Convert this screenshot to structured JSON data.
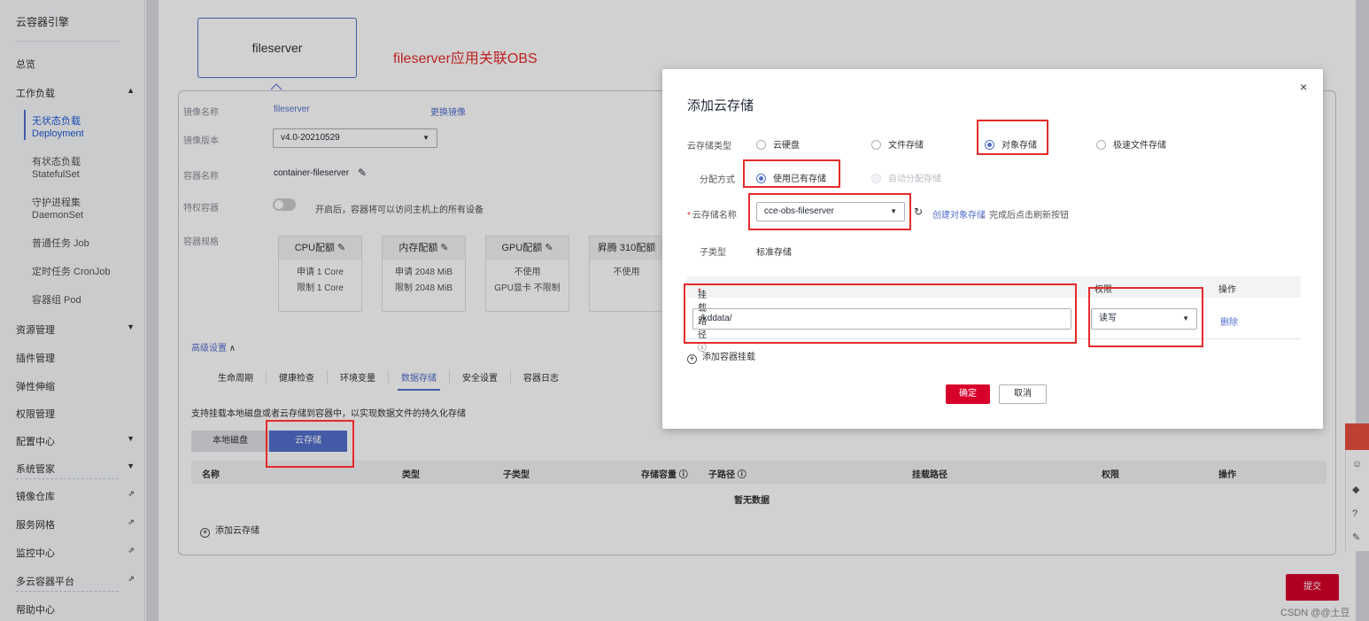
{
  "sidebar": {
    "title": "云容器引擎",
    "overview": "总览",
    "workload": "工作负载",
    "subs": [
      {
        "line1": "无状态负载",
        "line2": "Deployment"
      },
      {
        "line1": "有状态负载",
        "line2": "StatefulSet"
      },
      {
        "line1": "守护进程集",
        "line2": "DaemonSet"
      },
      {
        "line1": "普通任务 Job",
        "line2": ""
      },
      {
        "line1": "定时任务 CronJob",
        "line2": ""
      },
      {
        "line1": "容器组 Pod",
        "line2": ""
      }
    ],
    "items": [
      "资源管理",
      "插件管理",
      "弹性伸缩",
      "权限管理",
      "配置中心",
      "系统管家",
      "镜像仓库",
      "服务网格",
      "监控中心",
      "多云容器平台",
      "帮助中心"
    ]
  },
  "app_card": {
    "name": "fileserver"
  },
  "caption": "fileserver应用关联OBS",
  "form": {
    "image_name_label": "镜像名称",
    "image_name": "fileserver",
    "change_image": "更换镜像",
    "image_version_label": "镜像版本",
    "image_version": "v4.0-20210529",
    "container_name_label": "容器名称",
    "container_name": "container-fileserver",
    "privileged_label": "特权容器",
    "privileged_hint": "开启后，容器将可以访问主机上的所有设备",
    "spec_label": "容器规格",
    "quotas": [
      {
        "head": "CPU配额",
        "l1": "申请 1 Core",
        "l2": "限制 1 Core"
      },
      {
        "head": "内存配额",
        "l1": "申请 2048 MiB",
        "l2": "限制 2048 MiB"
      },
      {
        "head": "GPU配额",
        "l1": "不使用",
        "l2": "GPU显卡 不限制"
      },
      {
        "head": "昇腾 310配额",
        "l1": "不使用",
        "l2": ""
      }
    ],
    "advanced": "高级设置",
    "tabs": [
      "生命周期",
      "健康检查",
      "环境变量",
      "数据存储",
      "安全设置",
      "容器日志"
    ],
    "storage_hint": "支持挂载本地磁盘或者云存储到容器中，以实现数据文件的持久化存储",
    "seg_local": "本地磁盘",
    "seg_cloud": "云存储",
    "table_headers": [
      "名称",
      "类型",
      "子类型",
      "存储容量 ⓘ",
      "子路径 ⓘ",
      "挂载路径",
      "权限",
      "操作"
    ],
    "no_data": "暂无数据",
    "add_cloud_storage": "添加云存储"
  },
  "submit": "提交",
  "watermark": "CSDN @@土豆",
  "modal": {
    "title": "添加云存储",
    "close": "×",
    "type_label": "云存储类型",
    "types": [
      "云硬盘",
      "文件存储",
      "对象存储",
      "极速文件存储"
    ],
    "alloc_label": "分配方式",
    "allocs": [
      "使用已有存储",
      "自动分配存储"
    ],
    "name_label": "云存储名称",
    "name_value": "cce-obs-fileserver",
    "create_link": "创建对象存储",
    "create_hint": "，完成后点击刷新按钮",
    "subtype_label": "子类型",
    "subtype_value": "标准存储",
    "col_mount": "挂载路径 ⓘ",
    "col_perm": "权限",
    "col_op": "操作",
    "mount_value": "/kddata/",
    "perm_value": "读写",
    "delete": "删除",
    "add_mount": "添加容器挂载",
    "ok": "确定",
    "cancel": "取消"
  }
}
